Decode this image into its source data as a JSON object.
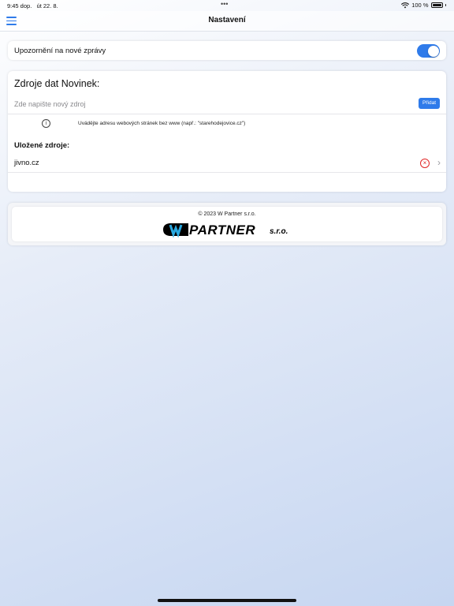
{
  "status_bar": {
    "time": "9:45 dop.",
    "date": "út 22. 8.",
    "dots": "•••",
    "battery": "100 %"
  },
  "nav": {
    "title": "Nastavení"
  },
  "notifications": {
    "label": "Upozornění na nové zprávy",
    "enabled": true
  },
  "sources": {
    "title": "Zdroje dat Novinek:",
    "input_placeholder": "Zde napište nový zdroj",
    "input_value": "",
    "add_label": "Přidat",
    "hint": "Uvádějte adresu webových stránek bez www (např.: \"starehodejovice.cz\")",
    "saved_title": "Uložené zdroje:",
    "saved": [
      {
        "domain": "jivno.cz"
      }
    ]
  },
  "footer": {
    "copyright": "© 2023 W Partner s.r.o.",
    "logo_text": "PARTNER",
    "logo_suffix": "s.r.o."
  },
  "colors": {
    "accent": "#2f7bea",
    "delete": "#e02424"
  }
}
